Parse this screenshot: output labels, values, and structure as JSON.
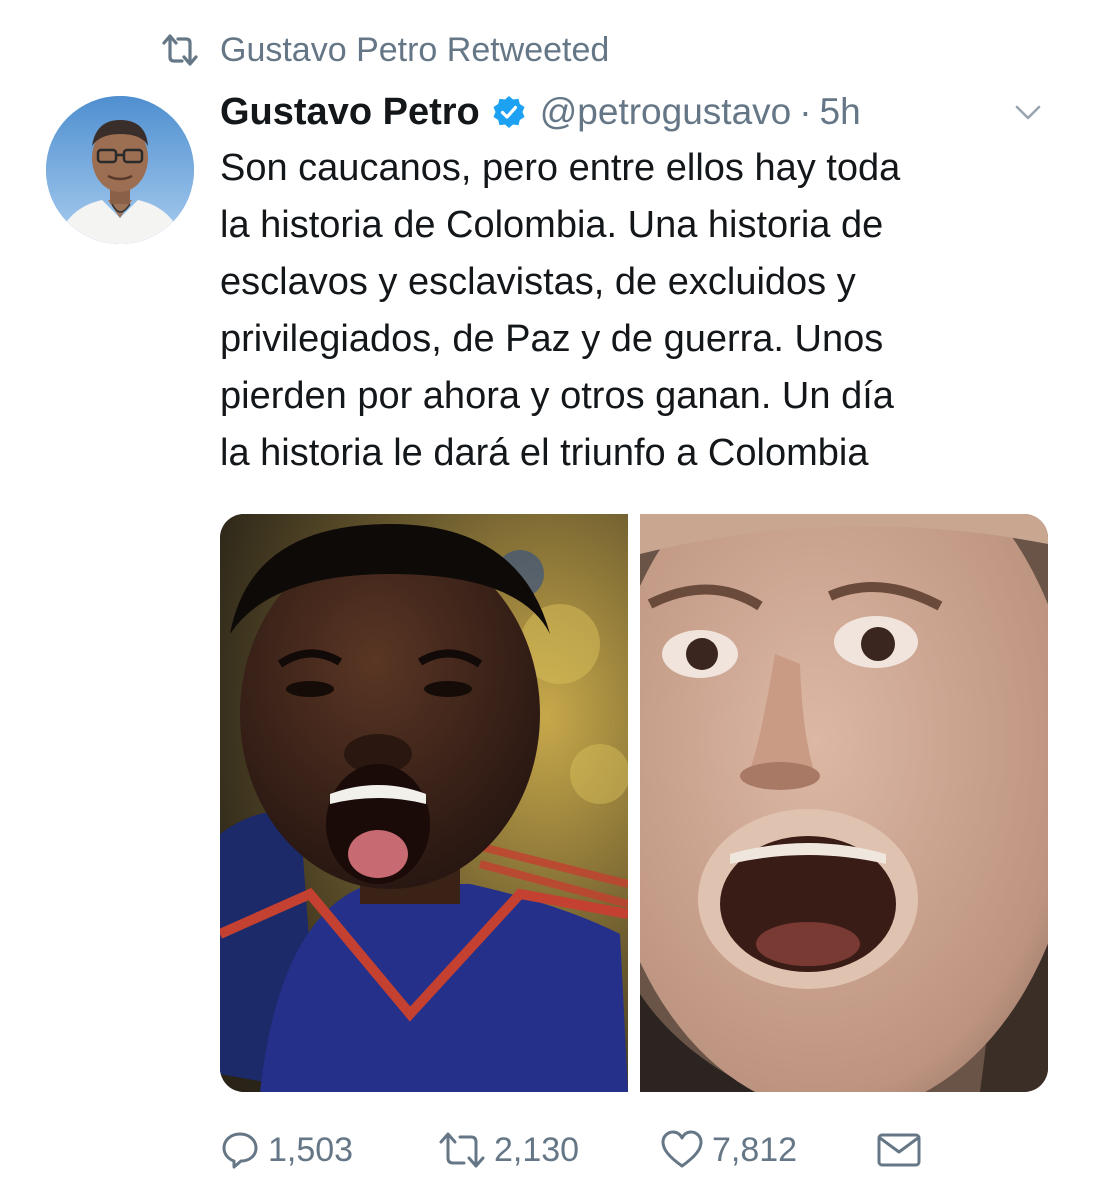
{
  "retweet_banner": {
    "text": "Gustavo Petro Retweeted",
    "icon": "retweet-icon"
  },
  "author": {
    "display_name": "Gustavo Petro",
    "verified": true,
    "handle": "@petrogustavo",
    "separator": "·",
    "time": "5h"
  },
  "tweet": {
    "lines": [
      "Son caucanos, pero entre ellos hay toda",
      "la historia de Colombia. Una historia de",
      "esclavos y esclavistas, de excluidos y",
      "privilegiados, de Paz y de guerra. Unos",
      "pierden por ahora y otros ganan. Un día",
      "la historia le dará el triunfo a Colombia"
    ]
  },
  "actions": {
    "replies": "1,503",
    "retweets": "2,130",
    "likes": "7,812"
  },
  "colors": {
    "accent": "#1da1f2",
    "secondary_text": "#657786",
    "primary_text": "#14171a"
  }
}
